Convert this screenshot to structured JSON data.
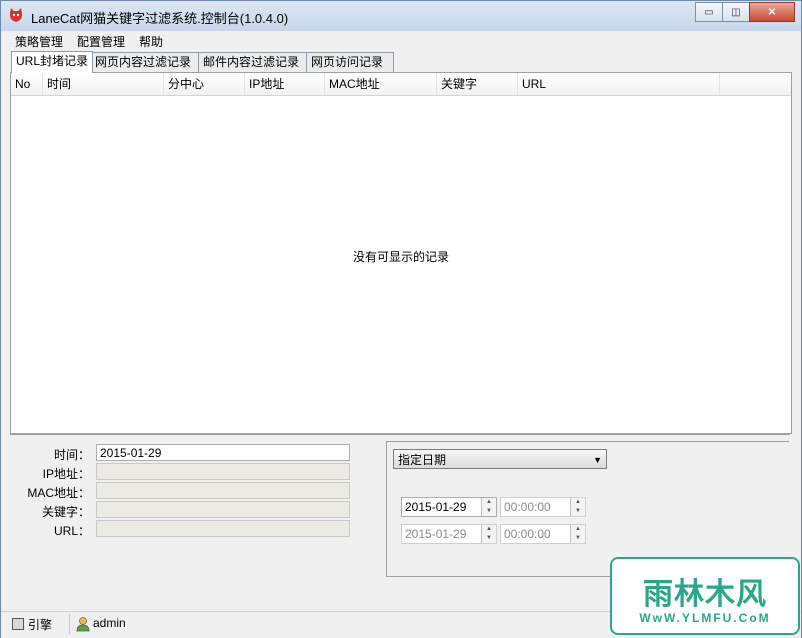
{
  "window": {
    "title": "LaneCat网猫关键字过滤系统.控制台(1.0.4.0)",
    "minimize_glyph": "▭",
    "maximize_glyph": "◫",
    "close_glyph": "✕"
  },
  "menu": [
    {
      "label": "策略管理"
    },
    {
      "label": "配置管理"
    },
    {
      "label": "帮助"
    }
  ],
  "tabs": [
    {
      "label": "URL封堵记录",
      "active": true
    },
    {
      "label": "网页内容过滤记录"
    },
    {
      "label": "邮件内容过滤记录"
    },
    {
      "label": "网页访问记录"
    }
  ],
  "table": {
    "columns": [
      "No",
      "时间",
      "分中心",
      "IP地址",
      "MAC地址",
      "关键字",
      "URL"
    ],
    "rows": [],
    "empty_message": "没有可显示的记录"
  },
  "details": {
    "time_label": "时间：",
    "time_value": "2015-01-29",
    "ip_label": "IP地址：",
    "ip_value": "",
    "mac_label": "MAC地址：",
    "mac_value": "",
    "keyword_label": "关键字：",
    "keyword_value": "",
    "url_label": "URL：",
    "url_value": ""
  },
  "filter": {
    "mode": "指定日期",
    "start_date": "2015-01-29",
    "start_time": "00:00:00",
    "end_date": "2015-01-29",
    "end_time": "00:00:00"
  },
  "statusbar": {
    "engine_label": "引擎",
    "user": "admin"
  },
  "watermark": {
    "brand": "雨林木风",
    "url": "WwW.YLMFU.CoM"
  },
  "colors": {
    "title_gradient": "#c6d6ea",
    "watermark": "#2aa789"
  }
}
